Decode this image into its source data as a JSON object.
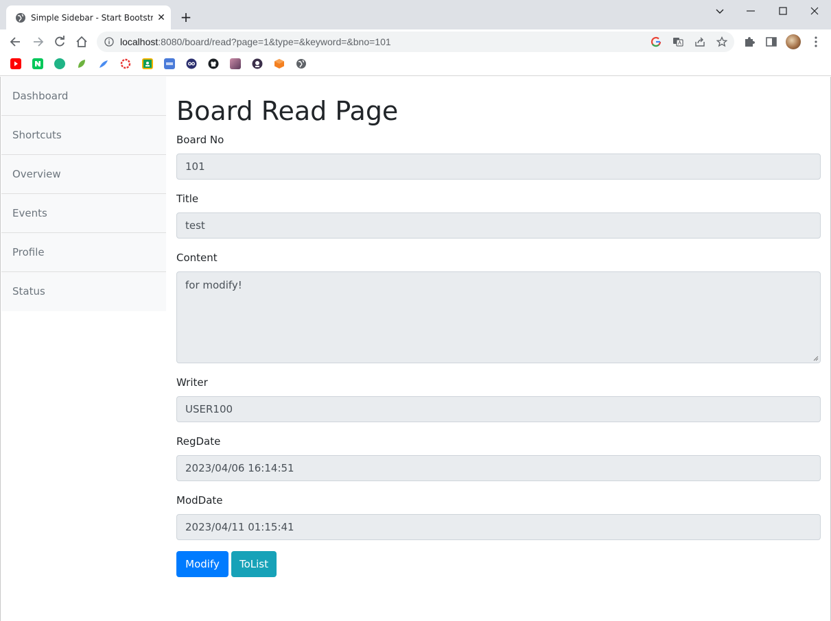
{
  "browser": {
    "tab_title": "Simple Sidebar - Start Bootstrap",
    "url_host": "localhost",
    "url_rest": ":8080/board/read?page=1&type=&keyword=&bno=101"
  },
  "sidebar": {
    "items": [
      {
        "label": "Dashboard"
      },
      {
        "label": "Shortcuts"
      },
      {
        "label": "Overview"
      },
      {
        "label": "Events"
      },
      {
        "label": "Profile"
      },
      {
        "label": "Status"
      }
    ]
  },
  "main": {
    "title": "Board Read Page",
    "fields": {
      "bno": {
        "label": "Board No",
        "value": "101"
      },
      "title": {
        "label": "Title",
        "value": "test"
      },
      "content": {
        "label": "Content",
        "value": "for modify!"
      },
      "writer": {
        "label": "Writer",
        "value": "USER100"
      },
      "regdate": {
        "label": "RegDate",
        "value": "2023/04/06 16:14:51"
      },
      "moddate": {
        "label": "ModDate",
        "value": "2023/04/11 01:15:41"
      }
    },
    "buttons": {
      "modify": "Modify",
      "tolist": "ToList"
    }
  },
  "colors": {
    "primary": "#007bff",
    "info": "#17a2b8",
    "readonly_bg": "#e9ecef",
    "sidebar_bg": "#f8f9fa"
  },
  "icons": {
    "bookmarks": [
      "youtube-icon",
      "naver-icon",
      "3ds-icon",
      "leaf-icon",
      "blue-feather-icon",
      "red-ring-icon",
      "yellow-classroom-icon",
      "blue-grid-icon",
      "owl-icon",
      "github-icon",
      "photo-icon",
      "dark-avatar-icon",
      "orange-box-icon",
      "globe-icon"
    ]
  }
}
